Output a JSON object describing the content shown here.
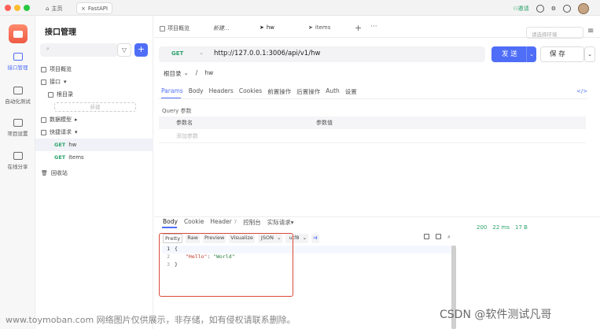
{
  "window": {
    "tabs": [
      {
        "label": "主页"
      },
      {
        "label": "FastAPI"
      }
    ],
    "invite_label": "邀请"
  },
  "rail": {
    "items": [
      {
        "label": "接口管理"
      },
      {
        "label": "自动化测试"
      },
      {
        "label": "项目设置"
      },
      {
        "label": "在线分享"
      }
    ]
  },
  "sidebar": {
    "title": "接口管理",
    "search_placeholder": "",
    "add_label": "+",
    "tree": [
      {
        "label": "项目概览"
      },
      {
        "label": "接口"
      },
      {
        "label": "根目录"
      },
      {
        "label": "新建"
      },
      {
        "label": "数据模型"
      },
      {
        "label": "快捷请求"
      },
      {
        "method": "GET",
        "label": "hw"
      },
      {
        "method": "GET",
        "label": "items"
      },
      {
        "label": "回收站"
      }
    ]
  },
  "main": {
    "tabs": [
      {
        "label": "项目概览"
      },
      {
        "label": "新建..."
      },
      {
        "label": "hw"
      },
      {
        "label": "items"
      }
    ],
    "tab_more": "···",
    "env_placeholder": "请选择环境",
    "request": {
      "method": "GET",
      "url": "http://127.0.0.1:3006/api/v1/hw",
      "send_label": "发 送",
      "save_label": "保 存"
    },
    "breadcrumb": [
      "根目录",
      "/",
      "hw"
    ],
    "request_tabs": [
      "Params",
      "Body",
      "Headers",
      "Cookies",
      "前置操作",
      "后置操作",
      "Auth",
      "设置"
    ],
    "code_toggle": "</>",
    "query_label": "Query 参数",
    "params_table": {
      "headers": [
        "参数名",
        "参数值"
      ],
      "add_placeholder": "添加参数"
    }
  },
  "response": {
    "tabs": [
      {
        "label": "Body"
      },
      {
        "label": "Cookie"
      },
      {
        "label": "Header",
        "count": "7"
      },
      {
        "label": "控制台"
      },
      {
        "label": "实际请求"
      }
    ],
    "status": {
      "code": "200",
      "time": "22 ms",
      "size": "17 B"
    },
    "view_tabs": [
      "Pretty",
      "Raw",
      "Preview",
      "Visualize",
      "JSON",
      "utf8"
    ],
    "code_lines": [
      {
        "n": "1",
        "text": "{"
      },
      {
        "n": "2",
        "key": "\"Hello\"",
        "value": "\"World\""
      },
      {
        "n": "3",
        "text": "}"
      }
    ]
  },
  "watermarks": {
    "left": "www.toymoban.com 网络图片仅供展示，非存储，如有侵权请联系删除。",
    "right": "CSDN @软件测试凡哥"
  }
}
